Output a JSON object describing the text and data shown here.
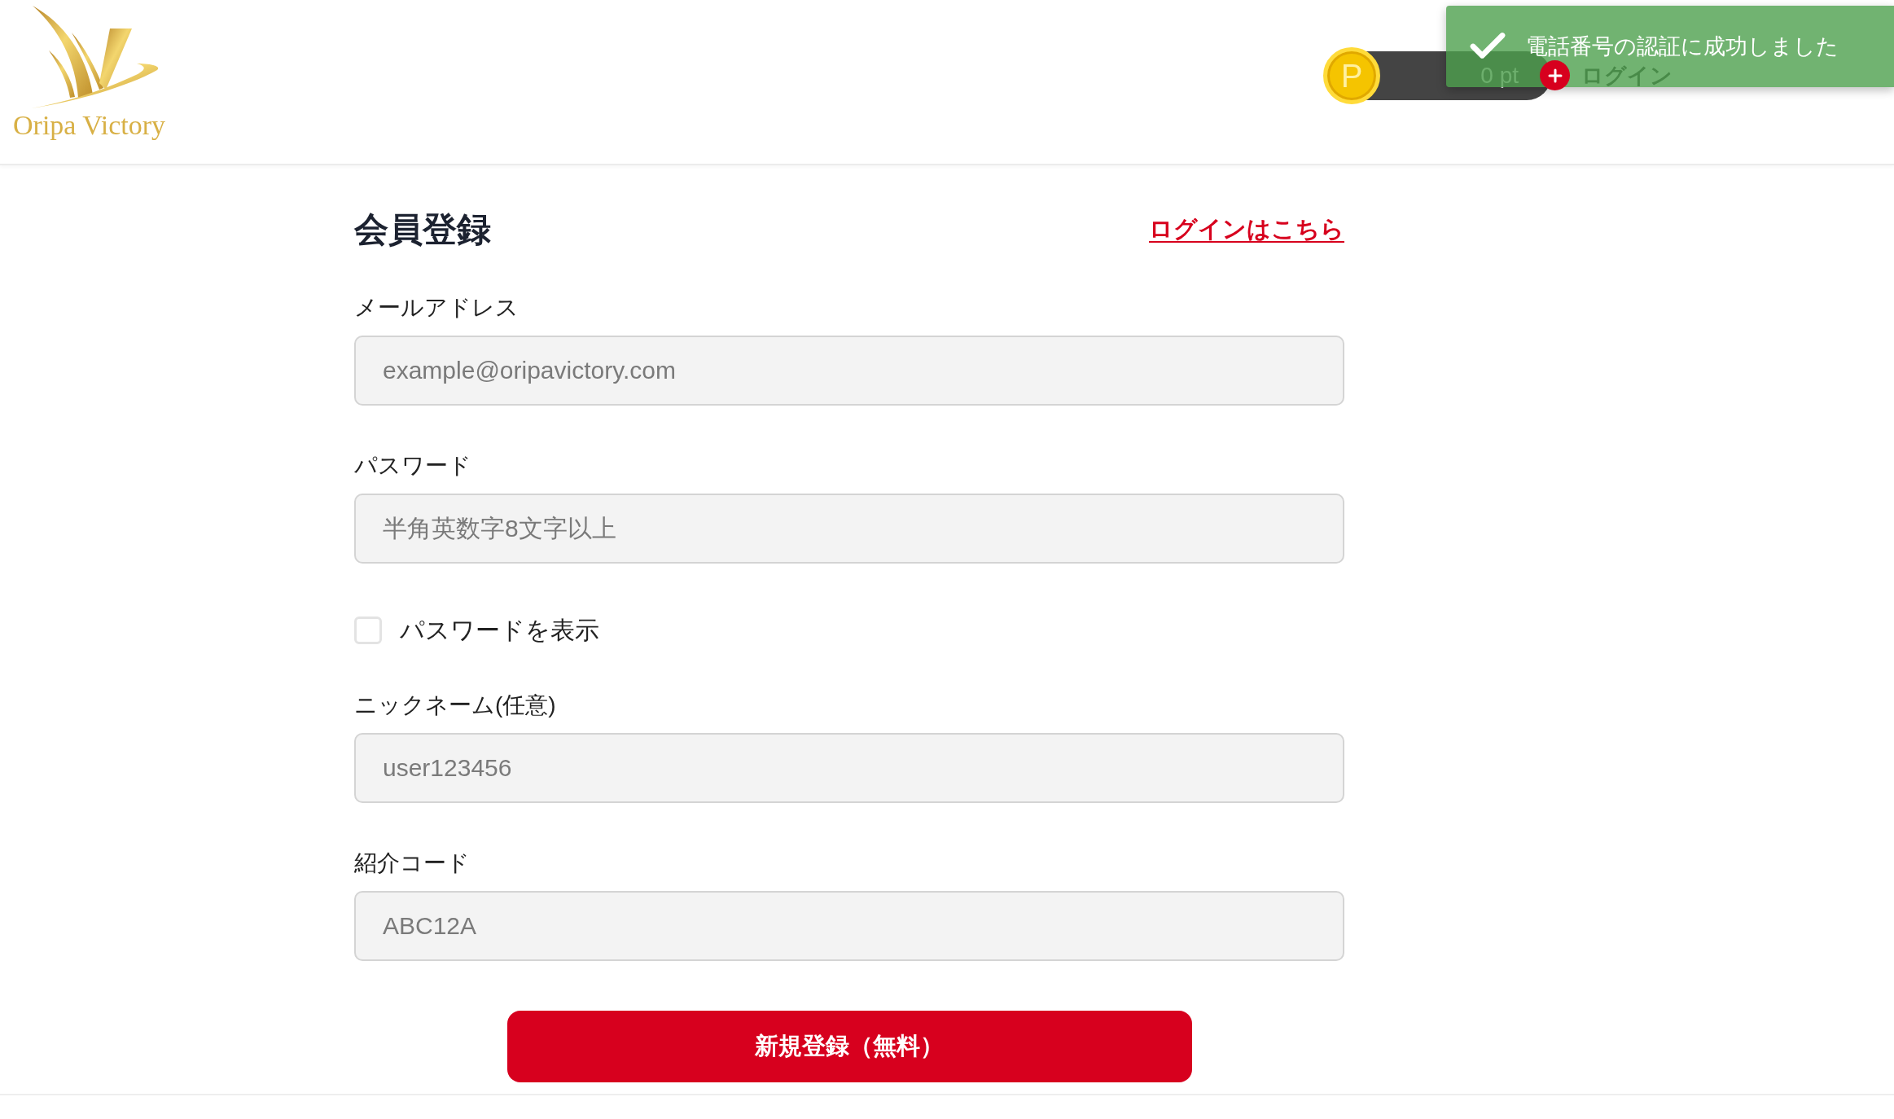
{
  "header": {
    "logo": {
      "text": "Oripa Victory"
    },
    "points": {
      "coin_symbol": "P",
      "balance": "0 pt"
    },
    "login": "ログイン"
  },
  "toast": {
    "kind": "success",
    "message": "電話番号の認証に成功しました"
  },
  "form": {
    "title": "会員登録",
    "login_link": "ログインはこちら",
    "fields": [
      {
        "kind": "input",
        "label": "メールアドレス",
        "placeholder": "example@oripavictory.com"
      },
      {
        "kind": "input",
        "label": "パスワード",
        "placeholder": "半角英数字8文字以上"
      },
      {
        "kind": "checkbox",
        "label": "パスワードを表示",
        "checked": false
      },
      {
        "kind": "input",
        "label": "ニックネーム(任意)",
        "placeholder": "user123456"
      },
      {
        "kind": "input",
        "label": "紹介コード",
        "placeholder": "ABC12A"
      }
    ],
    "submit": "新規登録（無料）"
  }
}
